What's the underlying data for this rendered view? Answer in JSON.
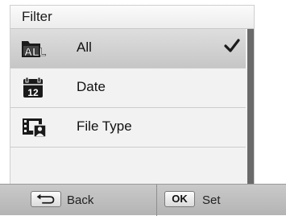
{
  "menu": {
    "title": "Filter",
    "items": [
      {
        "label": "All",
        "icon": "all-folder-icon",
        "selected": true
      },
      {
        "label": "Date",
        "icon": "calendar-icon",
        "selected": false
      },
      {
        "label": "File Type",
        "icon": "file-type-icon",
        "selected": false
      }
    ]
  },
  "softkeys": {
    "back": {
      "key_icon": "back-arrow-icon",
      "label": "Back"
    },
    "set": {
      "key": "OK",
      "label": "Set"
    }
  },
  "icons": {
    "all_text": "ALL",
    "calendar_day": "12"
  }
}
